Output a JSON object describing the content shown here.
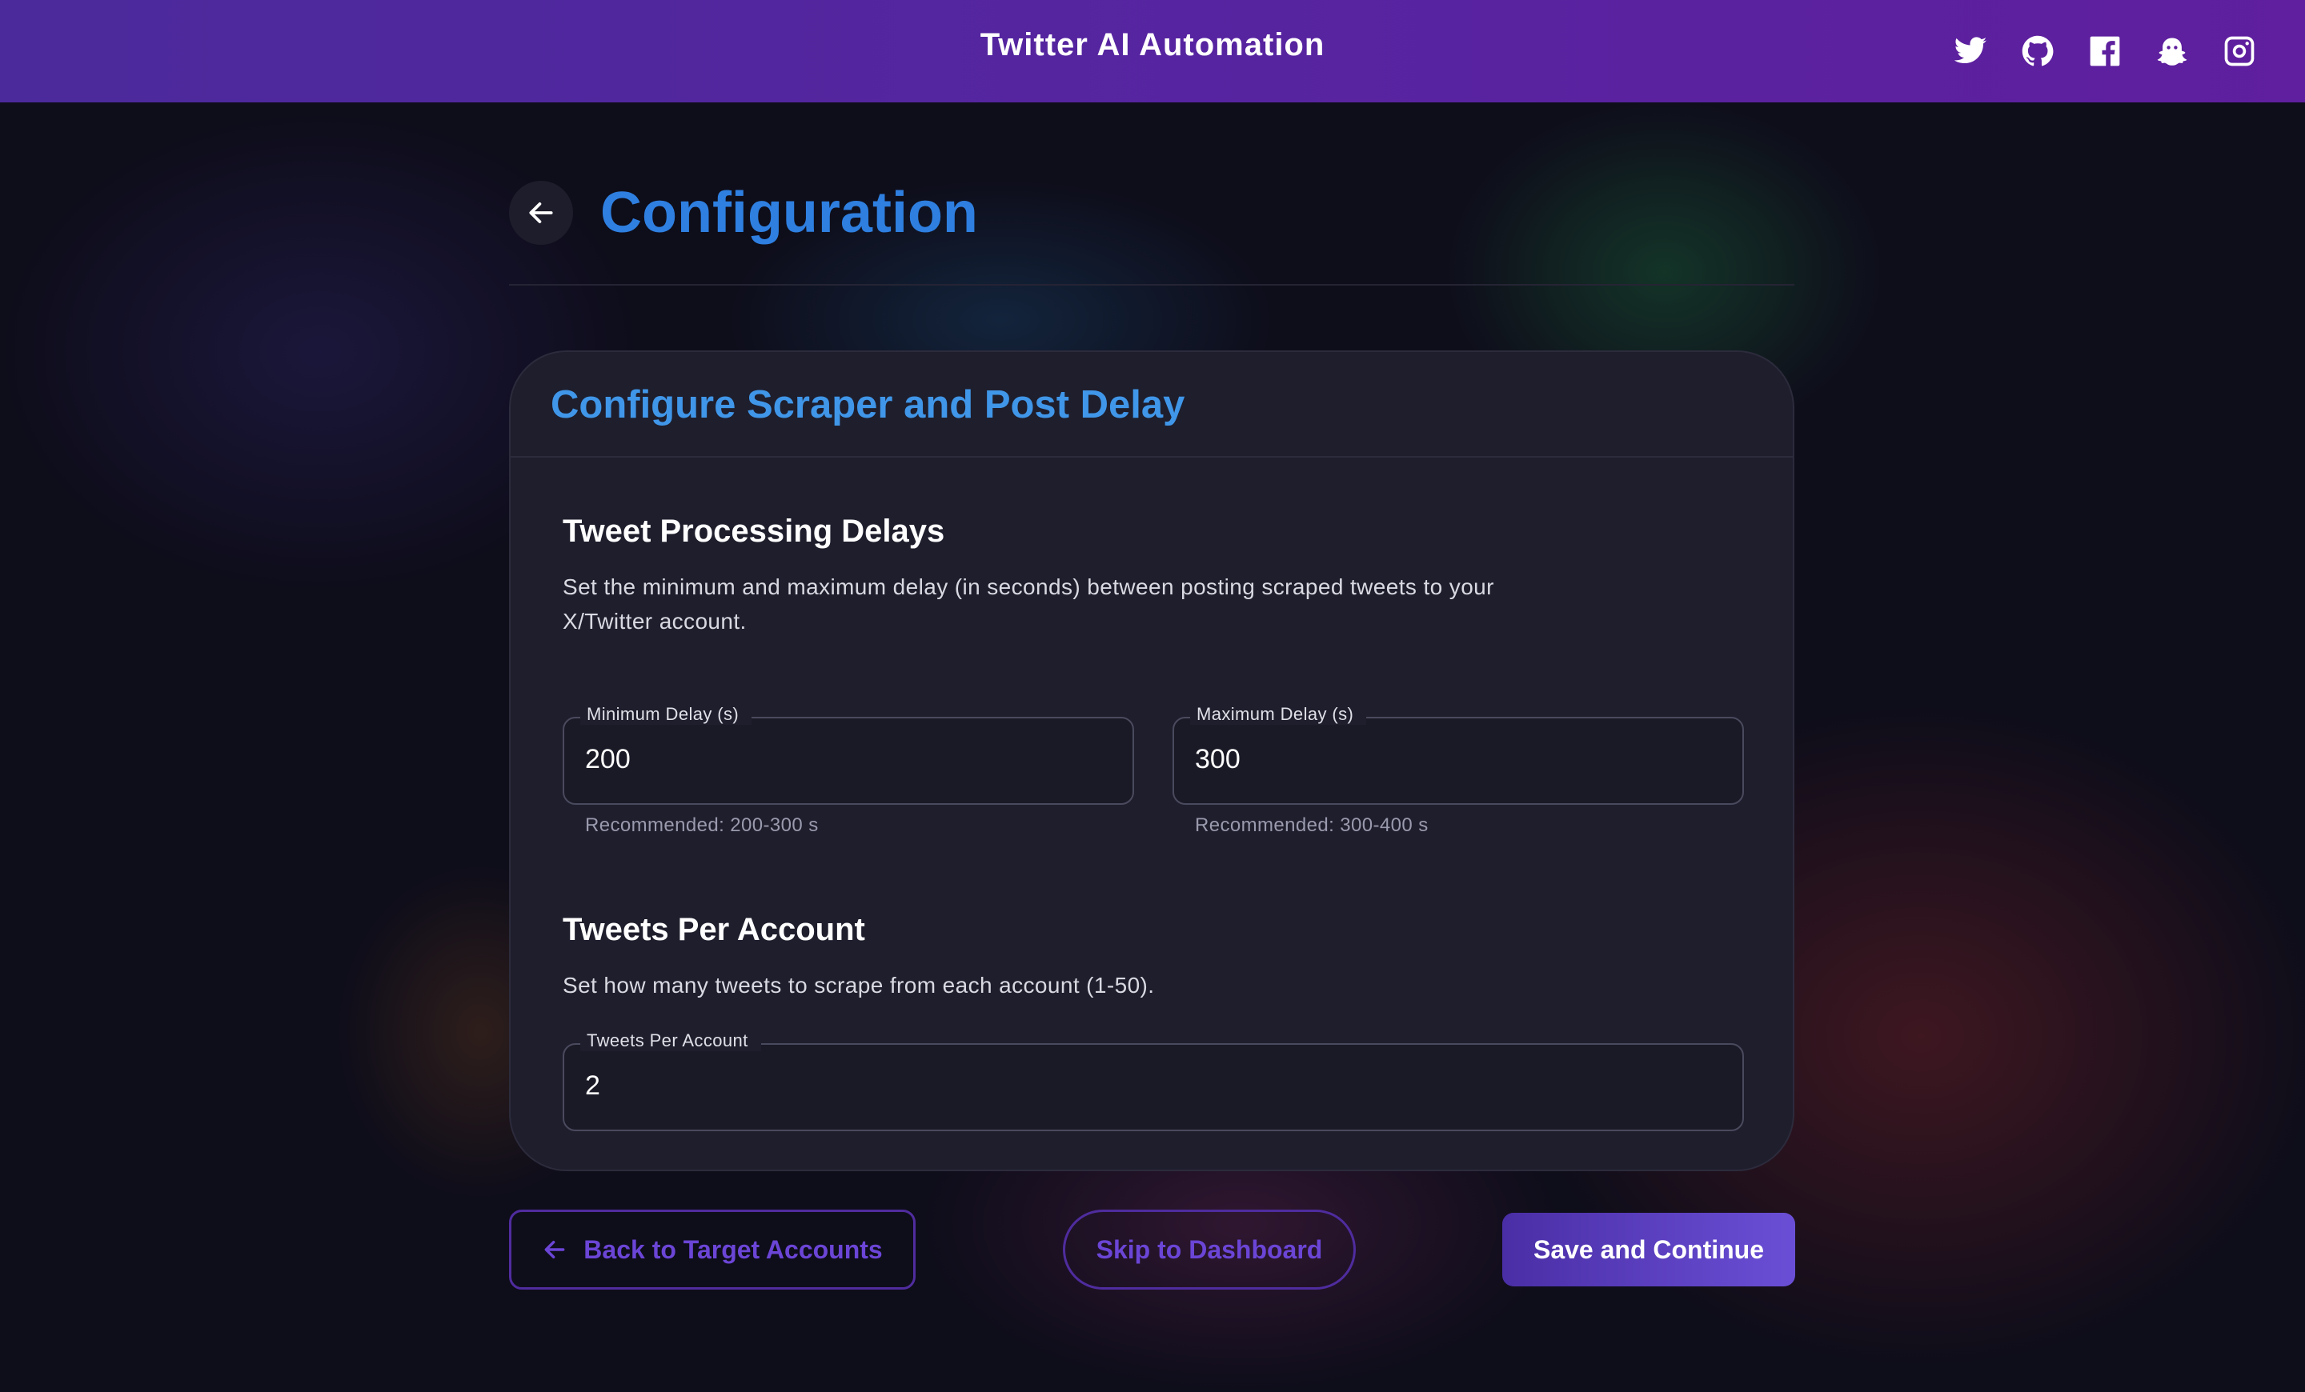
{
  "app": {
    "title": "Twitter AI Automation"
  },
  "social_icons": [
    "twitter-icon",
    "github-icon",
    "facebook-icon",
    "ghost-icon",
    "instagram-icon"
  ],
  "page": {
    "title": "Configuration"
  },
  "card": {
    "title": "Configure Scraper and Post Delay",
    "delays": {
      "title": "Tweet Processing Delays",
      "description_line1": "Set the minimum and maximum delay (in seconds) between posting scraped tweets to your",
      "description_line2": "X/Twitter account.",
      "min": {
        "label": "Minimum Delay (s)",
        "value": "200",
        "helper": "Recommended: 200-300 s"
      },
      "max": {
        "label": "Maximum Delay (s)",
        "value": "300",
        "helper": "Recommended: 300-400 s"
      }
    },
    "tweets": {
      "title": "Tweets Per Account",
      "description": "Set how many tweets to scrape from each account (1-50).",
      "field": {
        "label": "Tweets Per Account",
        "value": "2"
      }
    }
  },
  "buttons": {
    "back": "Back to Target Accounts",
    "skip": "Skip to Dashboard",
    "save": "Save and Continue"
  },
  "colors": {
    "accent": "#2e7fe0",
    "card_title": "#4096e8",
    "button_purple": "#6b45d6",
    "topbar": "#5724a0"
  }
}
